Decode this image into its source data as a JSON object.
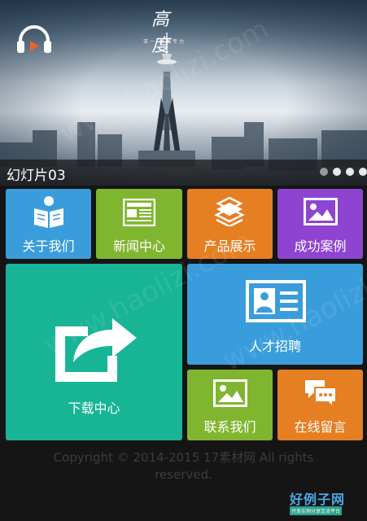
{
  "slider": {
    "caption": "幻灯片03",
    "brand_mark": "高度",
    "brand_sub": "亚一 特就专力",
    "dots": [
      {
        "active": true
      },
      {
        "active": false
      },
      {
        "active": false
      },
      {
        "active": false
      }
    ]
  },
  "tiles": {
    "about": {
      "label": "关于我们",
      "color": "#3a9ddb"
    },
    "news": {
      "label": "新闻中心",
      "color": "#80b530"
    },
    "products": {
      "label": "产品展示",
      "color": "#e67e22"
    },
    "cases": {
      "label": "成功案例",
      "color": "#8e44d1"
    },
    "download": {
      "label": "下载中心",
      "color": "#18b496"
    },
    "jobs": {
      "label": "人才招聘",
      "color": "#3a9ddb"
    },
    "contact": {
      "label": "联系我们",
      "color": "#80b530"
    },
    "message": {
      "label": "在线留言",
      "color": "#e67e22"
    }
  },
  "footer": {
    "copyright_line1": "Copyright © 2014-2015 17素材网 All rights",
    "copyright_line2": "reserved."
  },
  "watermark": {
    "logo_text": "好例子网",
    "logo_sub": "开发实例分享交流平台",
    "site": "www.haolizi.com"
  },
  "icons": {
    "audio": "headphones-icon",
    "about": "reading-person-icon",
    "news": "newspaper-icon",
    "products": "stacked-papers-icon",
    "cases": "picture-icon",
    "download": "share-arrow-icon",
    "jobs": "id-card-icon",
    "contact": "picture-icon",
    "message": "chat-bubbles-icon"
  }
}
